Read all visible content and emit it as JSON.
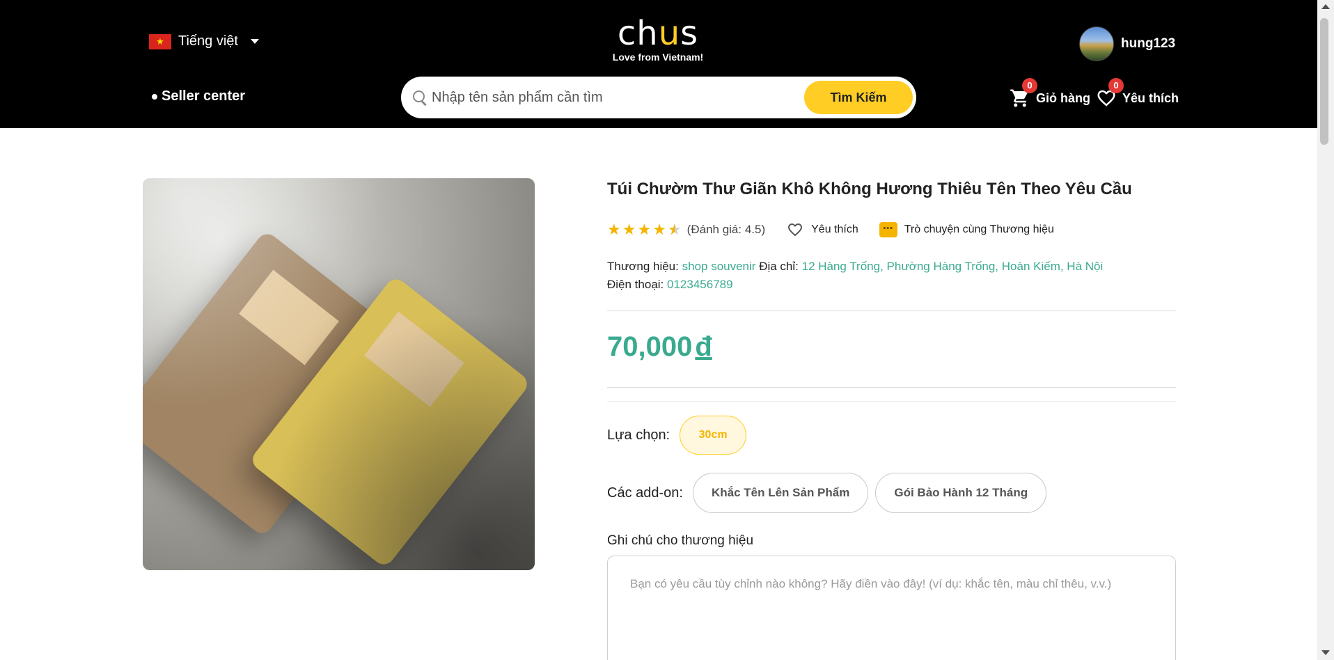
{
  "header": {
    "language": "Tiếng việt",
    "logo_word": "chus",
    "logo_tagline": "Love from Vietnam!",
    "username": "hung123",
    "seller_center": "Seller center",
    "search_placeholder": "Nhập tên sản phẩm cần tìm",
    "search_button": "Tìm Kiếm",
    "cart_label": "Giỏ hàng",
    "cart_count": "0",
    "wishlist_label": "Yêu thích",
    "wishlist_count": "0"
  },
  "product": {
    "title": "Túi Chườm Thư Giãn Khô Không Hương Thiêu Tên Theo Yêu Cầu",
    "rating": 4.5,
    "rating_text": "(Đánh giá: 4.5)",
    "favorite_label": "Yêu thích",
    "chat_label": "Trò chuyện cùng Thương hiệu",
    "brand_label": "Thương hiệu:",
    "brand_value": "shop souvenir",
    "address_label": "Địa chỉ:",
    "address_value": "12 Hàng Trống, Phường Hàng Trống, Hoàn Kiếm, Hà Nội",
    "phone_label": "Điện thoại:",
    "phone_value": "0123456789",
    "price": "70,000",
    "currency": "đ",
    "option_label": "Lựa chọn:",
    "option_selected": "30cm",
    "addon_label": "Các add-on:",
    "addons": [
      "Khắc Tên Lên Sản Phẩm",
      "Gói Bảo Hành 12 Tháng"
    ],
    "note_label": "Ghi chú cho thương hiệu",
    "note_placeholder": "Bạn có yêu cầu tùy chỉnh nào không? Hãy điền vào đây! (ví dụ: khắc tên, màu chỉ thêu, v.v.)"
  },
  "colors": {
    "accent_yellow": "#ffcd23",
    "accent_teal": "#3aaa8f",
    "header_bg": "#000000",
    "badge_red": "#e53935"
  }
}
